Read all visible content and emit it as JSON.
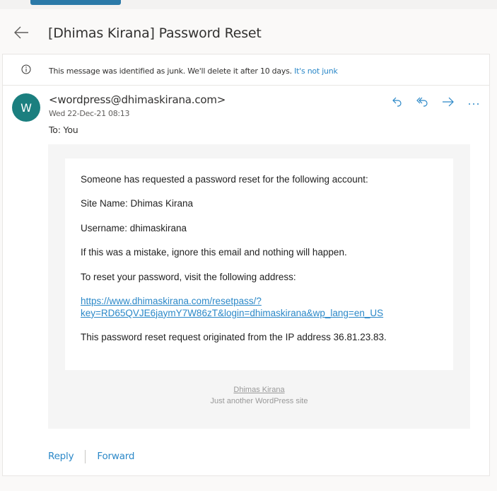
{
  "header": {
    "title": "[Dhimas Kirana] Password Reset",
    "back_icon": "back-arrow-icon"
  },
  "junk_notice": {
    "icon": "info-icon",
    "text": "This message was identified as junk. We'll delete it after 10 days.",
    "link": "It's not junk"
  },
  "message": {
    "avatar_letter": "W",
    "avatar_color": "#1b7f7f",
    "sender": "<wordpress@dhimaskirana.com>",
    "date": "Wed 22-Dec-21 08:13",
    "to": "To:  You",
    "actions": [
      {
        "name": "reply",
        "icon": "reply-icon"
      },
      {
        "name": "reply-all",
        "icon": "reply-all-icon"
      },
      {
        "name": "forward",
        "icon": "forward-icon"
      },
      {
        "name": "more",
        "icon": "more-icon"
      }
    ]
  },
  "email_body": {
    "line1": "Someone has requested a password reset for the following account:",
    "site_name": "Site Name: Dhimas Kirana",
    "username": "Username: dhimaskirana",
    "mistake": "If this was a mistake, ignore this email and nothing will happen.",
    "visit": "To reset your password, visit the following address:",
    "link_line1": "https://www.dhimaskirana.com/resetpass/?",
    "link_line2": "key=RD65QVJE6jaymY7W86zT&login=dhimaskirana&wp_lang=en_US",
    "ip_line": "This password reset request originated from the IP address 36.81.23.83."
  },
  "email_footer": {
    "site_link": "Dhimas Kirana",
    "tagline": "Just another WordPress site"
  },
  "bottom_actions": {
    "reply": "Reply",
    "forward": "Forward"
  },
  "colors": {
    "accent": "#2b88c8",
    "avatar": "#1b7f7f"
  }
}
